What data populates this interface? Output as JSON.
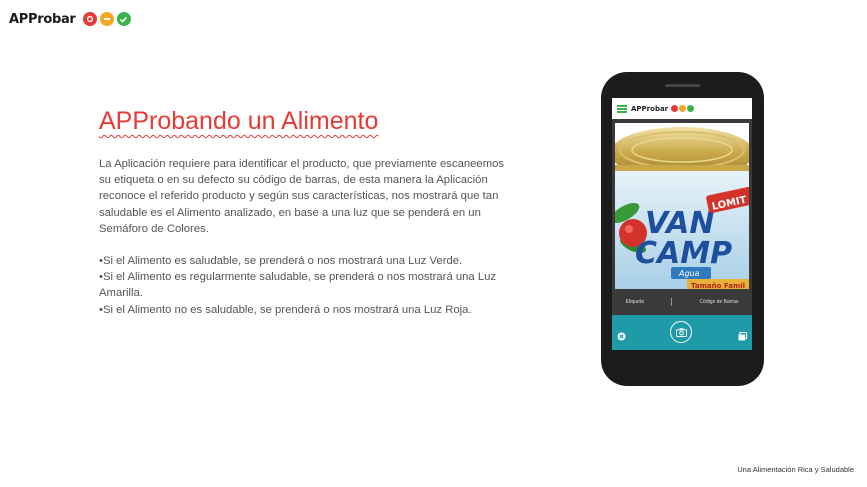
{
  "brand": {
    "logo_text": "APProbar",
    "colors": {
      "red": "#e63a35",
      "amber": "#f5a623",
      "green": "#3bb34a"
    }
  },
  "slide": {
    "title": "APProbando un Alimento",
    "paragraph": "La Aplicación requiere para identificar el producto, que previamente escaneemos su etiqueta o en su defecto su código de barras, de esta manera la Aplicación reconoce el referido producto y según sus características, nos mostrará que tan saludable es el Alimento analizado, en base a una luz que se penderá en un Semáforo de Colores.",
    "bullets": [
      "•Si el Alimento es saludable, se prenderá o nos mostrará una Luz Verde.",
      "•Si el Alimento es regularmente saludable, se prenderá o nos mostrará una Luz Amarilla.",
      "•Si el Alimento no es saludable, se prenderá o nos mostrará una Luz Roja."
    ],
    "footer": "Una Alimentación Rica y Saludable"
  },
  "phone": {
    "app_logo_text": "APProbar",
    "product_label": {
      "brand": "VAN CAMP'S",
      "badge": "LOMITOS",
      "variant": "Agua",
      "size": "Tamaño Familiar"
    },
    "tabs": [
      "Etiqueta",
      "Código de Barras"
    ],
    "icons": [
      "menu-icon",
      "close-icon",
      "camera-icon",
      "gallery-icon"
    ]
  }
}
